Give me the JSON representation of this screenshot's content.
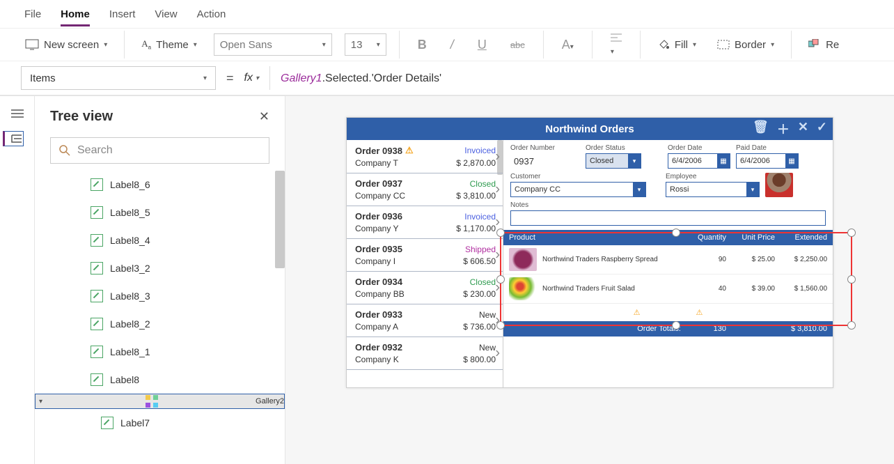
{
  "menubar": [
    "File",
    "Home",
    "Insert",
    "View",
    "Action"
  ],
  "menubar_active": 1,
  "ribbon": {
    "new_screen": "New screen",
    "theme": "Theme",
    "font_name": "Open Sans",
    "font_size": "13",
    "fill": "Fill",
    "border": "Border",
    "reorder": "Re"
  },
  "property_selector": "Items",
  "formula_prefix": "Gallery1",
  "formula_rest": ".Selected.'Order Details'",
  "tree": {
    "title": "Tree view",
    "search_placeholder": "Search",
    "items": [
      {
        "label": "Label8_6",
        "type": "label"
      },
      {
        "label": "Label8_5",
        "type": "label"
      },
      {
        "label": "Label8_4",
        "type": "label"
      },
      {
        "label": "Label3_2",
        "type": "label"
      },
      {
        "label": "Label8_3",
        "type": "label"
      },
      {
        "label": "Label8_2",
        "type": "label"
      },
      {
        "label": "Label8_1",
        "type": "label"
      },
      {
        "label": "Label8",
        "type": "label"
      },
      {
        "label": "Gallery2",
        "type": "gallery",
        "selected": true,
        "expanded": true
      },
      {
        "label": "Label7",
        "type": "label",
        "indent": 1
      }
    ]
  },
  "app": {
    "title": "Northwind Orders",
    "orders": [
      {
        "num": "Order 0938",
        "company": "Company T",
        "status": "Invoiced",
        "status_cls": "st-inv",
        "amount": "$ 2,870.00",
        "warn": true
      },
      {
        "num": "Order 0937",
        "company": "Company CC",
        "status": "Closed",
        "status_cls": "st-cls",
        "amount": "$ 3,810.00"
      },
      {
        "num": "Order 0936",
        "company": "Company Y",
        "status": "Invoiced",
        "status_cls": "st-inv",
        "amount": "$ 1,170.00"
      },
      {
        "num": "Order 0935",
        "company": "Company I",
        "status": "Shipped",
        "status_cls": "st-shp",
        "amount": "$ 606.50"
      },
      {
        "num": "Order 0934",
        "company": "Company BB",
        "status": "Closed",
        "status_cls": "st-cls",
        "amount": "$ 230.00"
      },
      {
        "num": "Order 0933",
        "company": "Company A",
        "status": "New",
        "status_cls": "st-new",
        "amount": "$ 736.00"
      },
      {
        "num": "Order 0932",
        "company": "Company K",
        "status": "New",
        "status_cls": "st-new",
        "amount": "$ 800.00"
      }
    ],
    "fields": {
      "order_number_lbl": "Order Number",
      "order_number": "0937",
      "order_status_lbl": "Order Status",
      "order_status": "Closed",
      "order_date_lbl": "Order Date",
      "order_date": "6/4/2006",
      "paid_date_lbl": "Paid Date",
      "paid_date": "6/4/2006",
      "customer_lbl": "Customer",
      "customer": "Company CC",
      "employee_lbl": "Employee",
      "employee": "Rossi",
      "notes_lbl": "Notes"
    },
    "grid": {
      "hdr_product": "Product",
      "hdr_qty": "Quantity",
      "hdr_price": "Unit Price",
      "hdr_ext": "Extended",
      "rows": [
        {
          "name": "Northwind Traders Raspberry Spread",
          "qty": "90",
          "price": "$ 25.00",
          "ext": "$ 2,250.00",
          "thumb": "radial-gradient(circle,#8e2a5b 45%,#e0bcd4 60%)"
        },
        {
          "name": "Northwind Traders Fruit Salad",
          "qty": "40",
          "price": "$ 39.00",
          "ext": "$ 1,560.00",
          "thumb": "radial-gradient(circle at 40% 40%,#d43 15%,#fc3 30%,#7b3 50%,#fff 70%)"
        }
      ]
    },
    "totals": {
      "label": "Order Totals:",
      "qty": "130",
      "amount": "$ 3,810.00"
    }
  }
}
